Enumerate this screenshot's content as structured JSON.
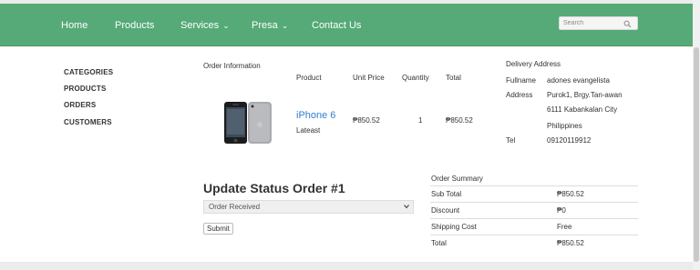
{
  "nav": {
    "home": "Home",
    "products": "Products",
    "services": "Services",
    "presa": "Presa",
    "contact": "Contact Us",
    "search_placeholder": "Search"
  },
  "sidebar": {
    "items": [
      "CATEGORIES",
      "PRODUCTS",
      "ORDERS",
      "CUSTOMERS"
    ]
  },
  "order": {
    "heading": "Order Information",
    "columns": {
      "product": "Product",
      "unit_price": "Unit Price",
      "quantity": "Quantity",
      "total": "Total"
    },
    "item": {
      "name": "iPhone 6",
      "tag": "Lateast",
      "unit_price": "₱850.52",
      "quantity": "1",
      "total": "₱850.52"
    }
  },
  "delivery": {
    "heading": "Delivery Address",
    "fullname_label": "Fullname",
    "fullname": "adones evangelista",
    "address_label": "Address",
    "address_lines": [
      "Purok1, Brgy.Tan-awan",
      "6111 Kabankalan City",
      "Philippines"
    ],
    "tel_label": "Tel",
    "tel": "09120119912"
  },
  "status": {
    "title": "Update Status Order #1",
    "selected": "Order Received",
    "submit": "Submit"
  },
  "summary": {
    "heading": "Order Summary",
    "rows": [
      {
        "label": "Sub Total",
        "value": "₱850.52"
      },
      {
        "label": "Discount",
        "value": "₱0"
      },
      {
        "label": "Shipping Cost",
        "value": "Free"
      },
      {
        "label": "Total",
        "value": "₱850.52"
      }
    ]
  },
  "colors": {
    "navbar": "#55aa77",
    "link": "#2f7fd0"
  }
}
